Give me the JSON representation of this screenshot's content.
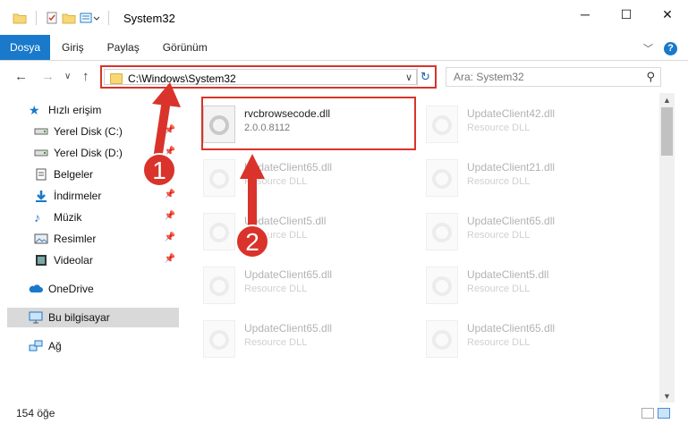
{
  "window": {
    "title": "System32",
    "controls": [
      "─",
      "☐",
      "✕"
    ]
  },
  "ribbon": {
    "tabs": [
      "Dosya",
      "Giriş",
      "Paylaş",
      "Görünüm"
    ],
    "expand_icon": "chevron-down-icon",
    "help_label": "?"
  },
  "address": {
    "path": "C:\\Windows\\System32",
    "search_placeholder": "Ara: System32"
  },
  "sidebar": {
    "quick_access": "Hızlı erişim",
    "items": [
      {
        "label": "Yerel Disk (C:)",
        "icon": "drive-icon",
        "pinned": true
      },
      {
        "label": "Yerel Disk (D:)",
        "icon": "drive-icon",
        "pinned": true
      },
      {
        "label": "Belgeler",
        "icon": "documents-icon",
        "pinned": true
      },
      {
        "label": "İndirmeler",
        "icon": "downloads-icon",
        "pinned": true
      },
      {
        "label": "Müzik",
        "icon": "music-icon",
        "pinned": true
      },
      {
        "label": "Resimler",
        "icon": "pictures-icon",
        "pinned": true
      },
      {
        "label": "Videolar",
        "icon": "videos-icon",
        "pinned": true
      }
    ],
    "onedrive": "OneDrive",
    "this_pc": "Bu bilgisayar",
    "network": "Ağ"
  },
  "files": {
    "highlighted": {
      "name": "rvcbrowsecode.dll",
      "sub": "2.0.0.8112"
    },
    "left_column": [
      {
        "name": "UpdateClient65.dll",
        "sub": "Resource DLL"
      },
      {
        "name": "UpdateClient5.dll",
        "sub": "Resource DLL"
      },
      {
        "name": "UpdateClient65.dll",
        "sub": "Resource DLL"
      },
      {
        "name": "UpdateClient65.dll",
        "sub": "Resource DLL"
      }
    ],
    "right_column": [
      {
        "name": "UpdateClient42.dll",
        "sub": "Resource DLL"
      },
      {
        "name": "UpdateClient21.dll",
        "sub": "Resource DLL"
      },
      {
        "name": "UpdateClient65.dll",
        "sub": "Resource DLL"
      },
      {
        "name": "UpdateClient5.dll",
        "sub": "Resource DLL"
      },
      {
        "name": "UpdateClient65.dll",
        "sub": "Resource DLL"
      }
    ]
  },
  "status": {
    "count": "154 öğe"
  },
  "annotations": {
    "step1": "1",
    "step2": "2",
    "color": "#d9332b"
  },
  "colors": {
    "accent": "#1979ca",
    "highlight_border": "#d9332b",
    "folder": "#f8d775"
  }
}
